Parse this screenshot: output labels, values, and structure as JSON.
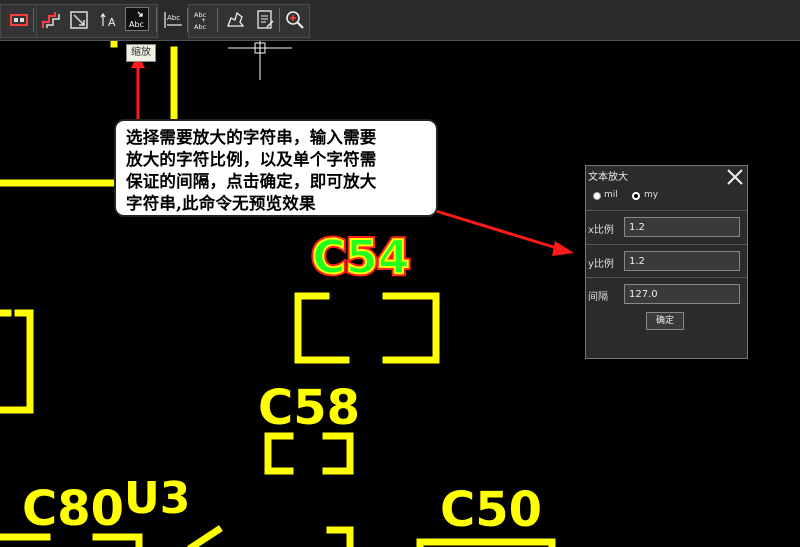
{
  "toolbar": {
    "tooltip": "缩放",
    "icons": [
      "route-icon",
      "step-route-icon",
      "auto-route-icon",
      "text-scale-icon",
      "text-enlarge-icon",
      "text-align-icon",
      "text-stack-icon",
      "shape-icon",
      "report-icon",
      "zoom-icon"
    ]
  },
  "canvas": {
    "designators": [
      {
        "label": "C54",
        "color": "#ff3030",
        "highlight": true
      },
      {
        "label": "C58",
        "color": "#ffff00"
      },
      {
        "label": "U3",
        "color": "#ffff00"
      },
      {
        "label": "C80",
        "color": "#ffff00"
      },
      {
        "label": "C50",
        "color": "#ffff00"
      }
    ]
  },
  "callout": {
    "lines": [
      "选择需要放大的字符串，输入需要",
      "放大的字符比例，以及单个字符需",
      "保证的间隔，点击确定，即可放大",
      "字符串,此命令无预览效果"
    ]
  },
  "dialog": {
    "title": "文本放大",
    "unit_options": [
      {
        "label": "mil",
        "selected": true
      },
      {
        "label": "my",
        "selected": false
      }
    ],
    "x_label": "x比例",
    "x_value": "1.2",
    "y_label": "y比例",
    "y_value": "1.2",
    "gap_label": "间隔",
    "gap_value": "127.0",
    "ok_label": "确定"
  },
  "colors": {
    "silkscreen": "#ffff00",
    "selected_outline": "#ff2020",
    "selected_fill": "#20ff20",
    "arrow": "#ff1a1a"
  }
}
